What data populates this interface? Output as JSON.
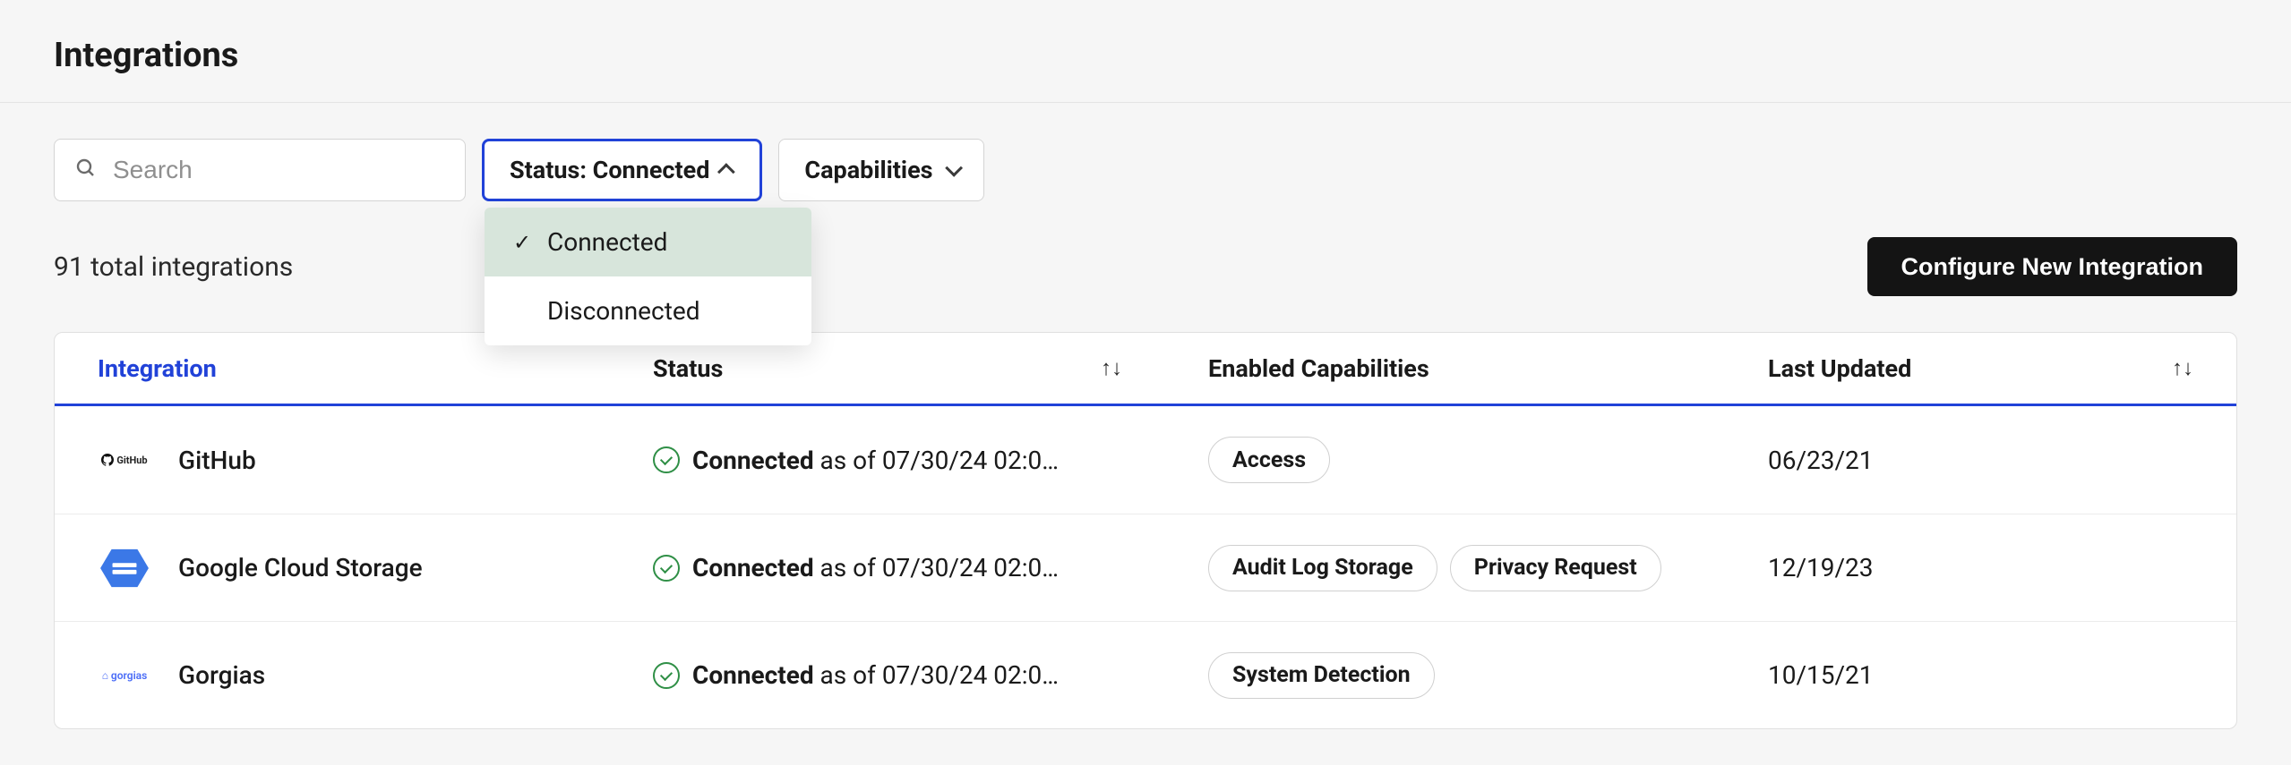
{
  "header": {
    "title": "Integrations"
  },
  "search": {
    "placeholder": "Search",
    "value": ""
  },
  "filters": {
    "status": {
      "label": "Status: Connected",
      "open": true,
      "options": [
        {
          "label": "Connected",
          "selected": true
        },
        {
          "label": "Disconnected",
          "selected": false
        }
      ]
    },
    "capabilities": {
      "label": "Capabilities",
      "open": false
    }
  },
  "summary": {
    "total_text": "91 total integrations"
  },
  "actions": {
    "configure_label": "Configure New Integration"
  },
  "table": {
    "columns": {
      "integration": "Integration",
      "status": "Status",
      "capabilities": "Enabled Capabilities",
      "updated": "Last Updated"
    },
    "rows": [
      {
        "logo": "github",
        "name": "GitHub",
        "status_label": "Connected",
        "status_asof": " as of 07/30/24 02:0…",
        "capabilities": [
          "Access"
        ],
        "updated": "06/23/21"
      },
      {
        "logo": "gcs",
        "name": "Google Cloud Storage",
        "status_label": "Connected",
        "status_asof": " as of 07/30/24 02:0…",
        "capabilities": [
          "Audit Log Storage",
          "Privacy Request"
        ],
        "updated": "12/19/23"
      },
      {
        "logo": "gorgias",
        "name": "Gorgias",
        "status_label": "Connected",
        "status_asof": " as of 07/30/24 02:0…",
        "capabilities": [
          "System Detection"
        ],
        "updated": "10/15/21"
      }
    ]
  }
}
